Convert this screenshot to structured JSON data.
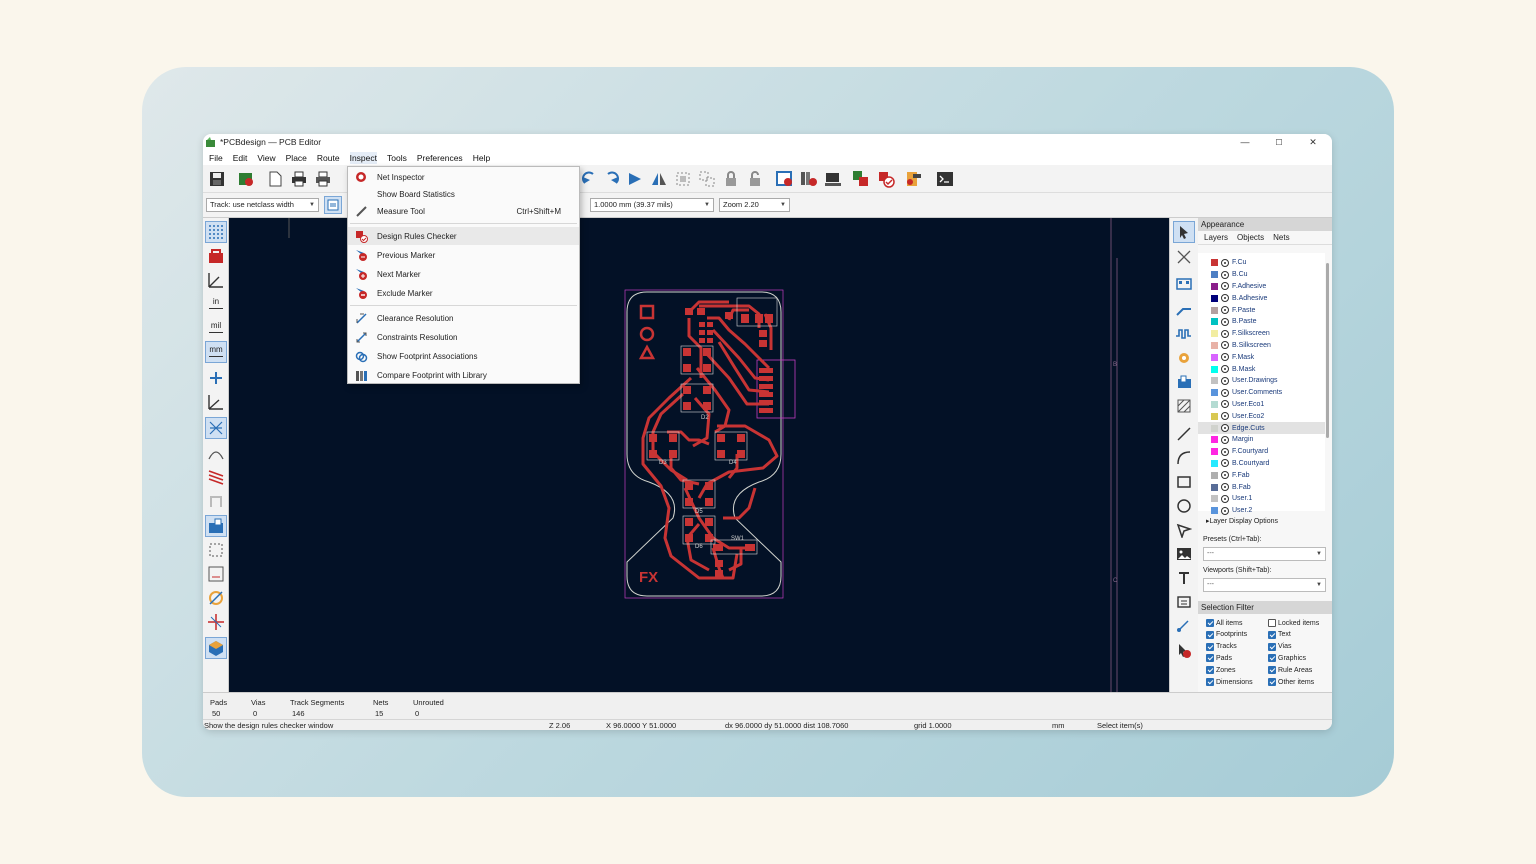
{
  "window": {
    "title": "*PCBdesign — PCB Editor"
  },
  "window_controls": {
    "minimize": "—",
    "maximize": "☐",
    "close": "✕"
  },
  "menubar": [
    "File",
    "Edit",
    "View",
    "Place",
    "Route",
    "Inspect",
    "Tools",
    "Preferences",
    "Help"
  ],
  "toolbar2": {
    "track_width": "Track: use netclass width",
    "grid": "1.0000 mm (39.37 mils)",
    "zoom": "Zoom 2.20"
  },
  "inspect_menu": {
    "items": [
      {
        "label": "Net Inspector",
        "shortcut": "",
        "icon": "net-inspector-icon"
      },
      {
        "label": "Show Board Statistics",
        "shortcut": "",
        "icon": ""
      },
      {
        "label": "Measure Tool",
        "shortcut": "Ctrl+Shift+M",
        "icon": "ruler-icon"
      },
      {
        "label": "Design Rules Checker",
        "shortcut": "",
        "icon": "drc-icon"
      },
      {
        "label": "Previous Marker",
        "shortcut": "",
        "icon": "previous-marker-icon"
      },
      {
        "label": "Next Marker",
        "shortcut": "",
        "icon": "next-marker-icon"
      },
      {
        "label": "Exclude Marker",
        "shortcut": "",
        "icon": "exclude-marker-icon"
      },
      {
        "label": "Clearance Resolution",
        "shortcut": "",
        "icon": "clearance-icon"
      },
      {
        "label": "Constraints Resolution",
        "shortcut": "",
        "icon": "constraints-icon"
      },
      {
        "label": "Show Footprint Associations",
        "shortcut": "",
        "icon": "footprint-assoc-icon"
      },
      {
        "label": "Compare Footprint with Library",
        "shortcut": "",
        "icon": "library-compare-icon"
      }
    ]
  },
  "appearance": {
    "title": "Appearance",
    "tabs": [
      "Layers",
      "Objects",
      "Nets"
    ],
    "layers": [
      {
        "name": "F.Cu",
        "color": "#c83434"
      },
      {
        "name": "B.Cu",
        "color": "#4d7fc4"
      },
      {
        "name": "F.Adhesive",
        "color": "#8a1e8a"
      },
      {
        "name": "B.Adhesive",
        "color": "#00007a"
      },
      {
        "name": "F.Paste",
        "color": "#b4a0a0"
      },
      {
        "name": "B.Paste",
        "color": "#00c2c2"
      },
      {
        "name": "F.Silkscreen",
        "color": "#f2eda1"
      },
      {
        "name": "B.Silkscreen",
        "color": "#e8b2a7"
      },
      {
        "name": "F.Mask",
        "color": "#d864ff"
      },
      {
        "name": "B.Mask",
        "color": "#02ffee"
      },
      {
        "name": "User.Drawings",
        "color": "#c2c2c2"
      },
      {
        "name": "User.Comments",
        "color": "#5994dc"
      },
      {
        "name": "User.Eco1",
        "color": "#b4dbd2"
      },
      {
        "name": "User.Eco2",
        "color": "#d8c852"
      },
      {
        "name": "Edge.Cuts",
        "color": "#d0d2cd"
      },
      {
        "name": "Margin",
        "color": "#ff26e2"
      },
      {
        "name": "F.Courtyard",
        "color": "#ff26e2"
      },
      {
        "name": "B.Courtyard",
        "color": "#26e9ff"
      },
      {
        "name": "F.Fab",
        "color": "#afafaf"
      },
      {
        "name": "B.Fab",
        "color": "#586d97"
      },
      {
        "name": "User.1",
        "color": "#c2c2c2"
      },
      {
        "name": "User.2",
        "color": "#5994dc"
      }
    ],
    "layer_display_options": "Layer Display Options",
    "presets_label": "Presets (Ctrl+Tab):",
    "presets_value": "---",
    "viewports_label": "Viewports (Shift+Tab):",
    "viewports_value": "---"
  },
  "selection_filter": {
    "title": "Selection Filter",
    "items": [
      {
        "label": "All items",
        "checked": true
      },
      {
        "label": "Locked items",
        "checked": false
      },
      {
        "label": "Footprints",
        "checked": true
      },
      {
        "label": "Text",
        "checked": true
      },
      {
        "label": "Tracks",
        "checked": true
      },
      {
        "label": "Vias",
        "checked": true
      },
      {
        "label": "Pads",
        "checked": true
      },
      {
        "label": "Graphics",
        "checked": true
      },
      {
        "label": "Zones",
        "checked": true
      },
      {
        "label": "Rule Areas",
        "checked": true
      },
      {
        "label": "Dimensions",
        "checked": true
      },
      {
        "label": "Other items",
        "checked": true
      }
    ]
  },
  "board_stats": {
    "labels": [
      "Pads",
      "Vias",
      "Track Segments",
      "Nets",
      "Unrouted"
    ],
    "values": [
      "50",
      "0",
      "146",
      "15",
      "0"
    ]
  },
  "status": {
    "message": "Show the design rules checker window",
    "zoom": "Z 2.06",
    "xy": "X 96.0000  Y 51.0000",
    "delta": "dx 96.0000  dy 51.0000  dist 108.7060",
    "grid": "grid 1.0000",
    "units": "mm",
    "mode": "Select item(s)"
  },
  "board_labels": {
    "logo": "FX",
    "sw": "SW1",
    "d2": "D2",
    "d3": "D3",
    "d4": "D4",
    "d5": "D5",
    "d6": "D6",
    "ruler_b": "B",
    "ruler_c": "C"
  },
  "left_tool_labels": {
    "inch": "in",
    "mil": "mil",
    "mm": "mm"
  },
  "colors": {
    "canvas": "#031126",
    "copper": "#c83434",
    "edge": "#d0d2cd"
  }
}
